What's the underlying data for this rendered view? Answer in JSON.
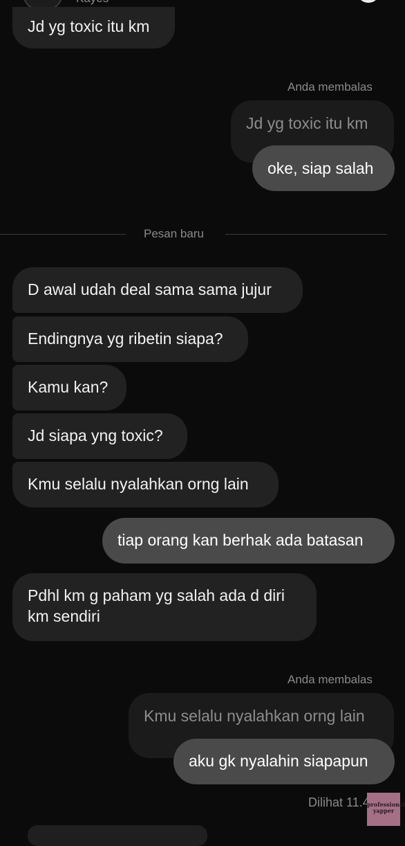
{
  "header": {
    "contact_name": "Kayes"
  },
  "messages": {
    "m1": "Jd yg toxic itu km",
    "reply1_label": "Anda membalas",
    "reply1_quote": "Jd yg toxic itu km",
    "reply1_text": "oke, siap salah",
    "divider_label": "Pesan baru",
    "m2": "D awal udah deal sama sama jujur",
    "m3": "Endingnya yg ribetin siapa?",
    "m4": "Kamu kan?",
    "m5": "Jd siapa yng toxic?",
    "m6": "Kmu selalu nyalahkan orng lain",
    "out1": "tiap orang kan berhak ada batasan",
    "m7_line1": "Pdhl km g paham yg salah ada d diri",
    "m7_line2": "km sendiri",
    "reply2_label": "Anda membalas",
    "reply2_quote": "Kmu selalu nyalahkan orng lain",
    "reply2_text": "aku gk nyalahin siapapun",
    "seen_status": "Dilihat 11.49"
  },
  "watermark": {
    "line1": "professional",
    "line2": "yapper"
  }
}
